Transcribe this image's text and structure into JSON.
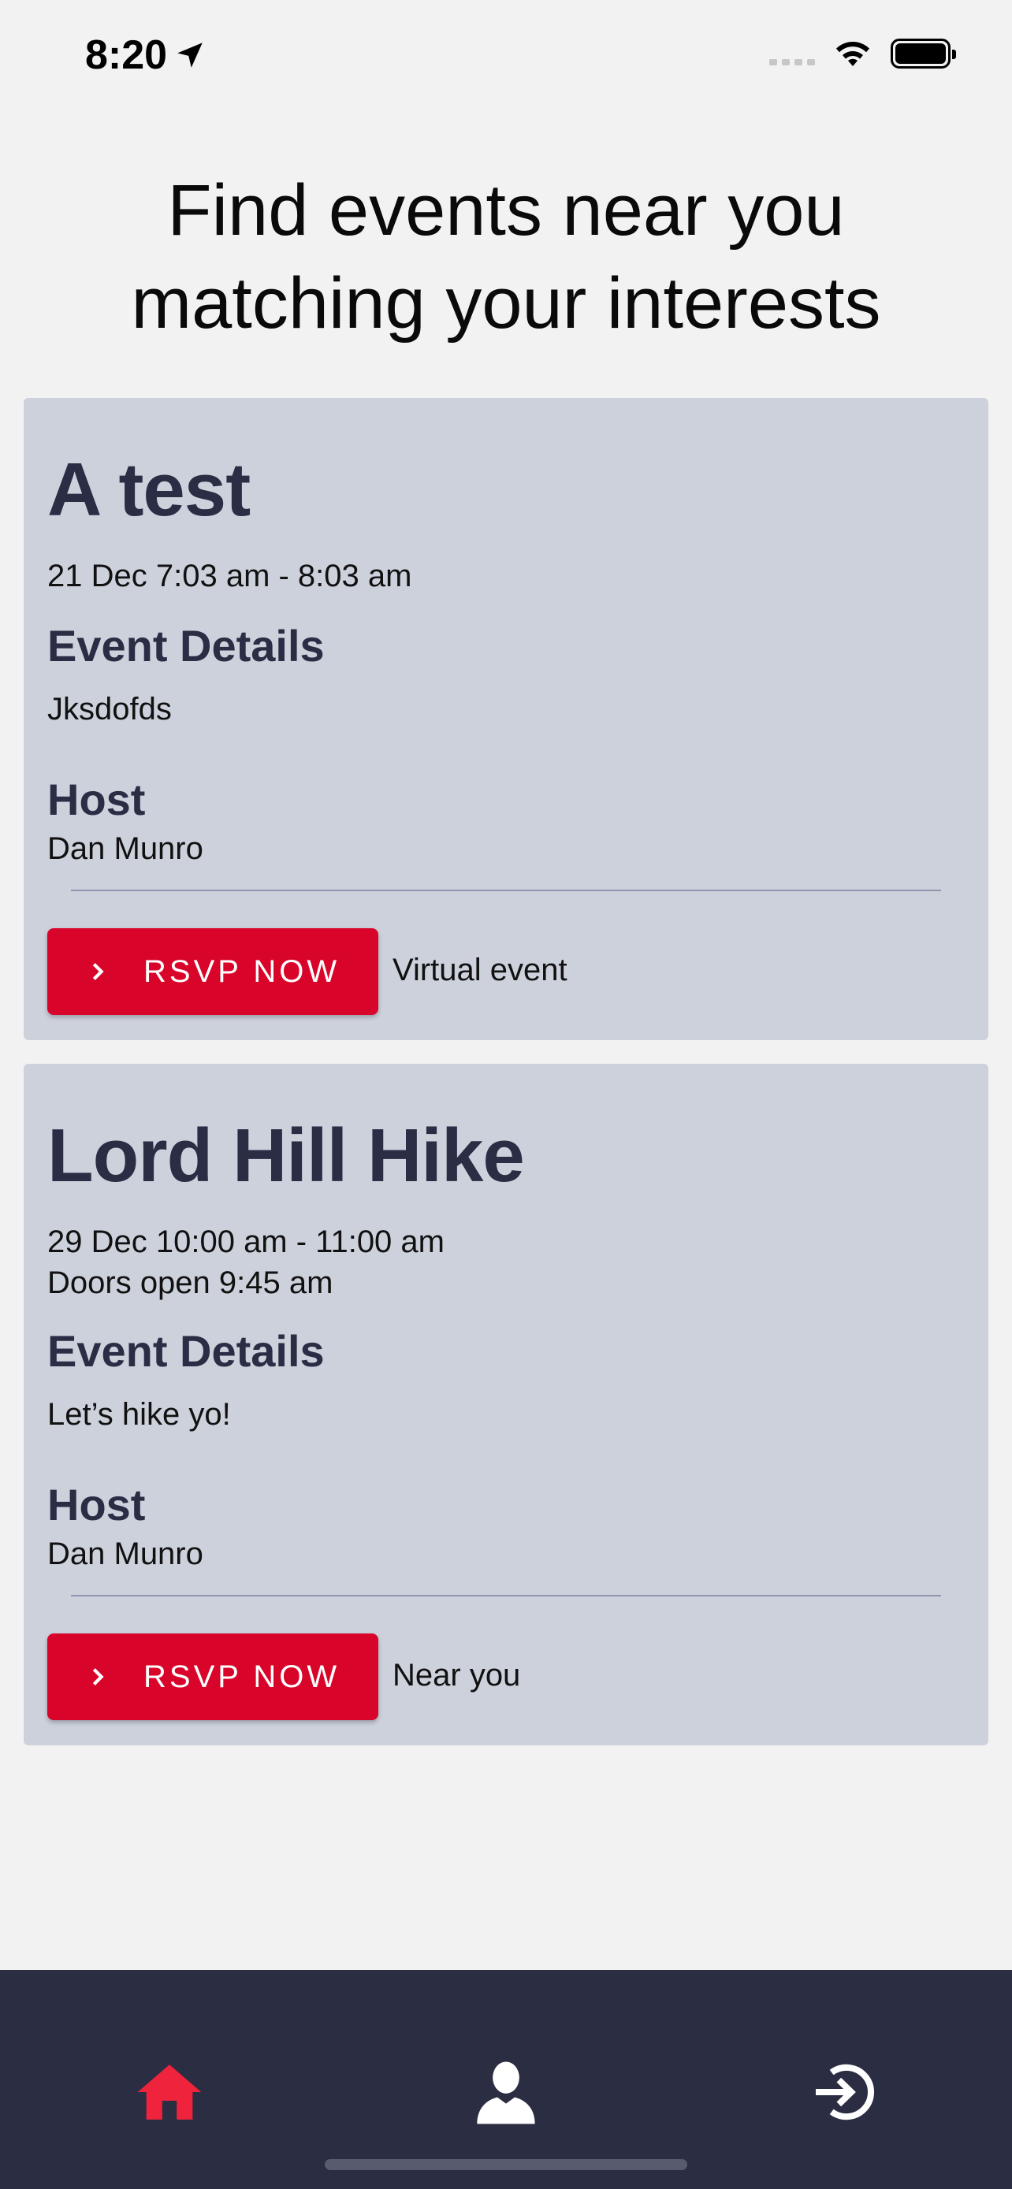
{
  "status_bar": {
    "time": "8:20"
  },
  "header": {
    "title": "Find events near you\nmatching your interests"
  },
  "events": [
    {
      "title": "A test",
      "time": "21 Dec 7:03 am - 8:03 am",
      "doors": "",
      "details_heading": "Event Details",
      "details": "Jksdofds",
      "host_heading": "Host",
      "host": "Dan Munro",
      "rsvp_label": "RSVP NOW",
      "location": "Virtual event"
    },
    {
      "title": "Lord Hill Hike",
      "time": "29 Dec 10:00 am - 11:00 am",
      "doors": "Doors open 9:45 am",
      "details_heading": "Event Details",
      "details": "Let’s hike yo!",
      "host_heading": "Host",
      "host": "Dan Munro",
      "rsvp_label": "RSVP NOW",
      "location": "Near you"
    }
  ],
  "tab_bar": {
    "items": [
      {
        "icon": "home-icon",
        "active": true
      },
      {
        "icon": "profile-icon",
        "active": false
      },
      {
        "icon": "sign-in-icon",
        "active": false
      }
    ]
  },
  "colors": {
    "accent": "#d90429",
    "card_bg": "#cdd1dc",
    "heading": "#2a2d44",
    "tab_bar_bg": "#2b2d42"
  }
}
